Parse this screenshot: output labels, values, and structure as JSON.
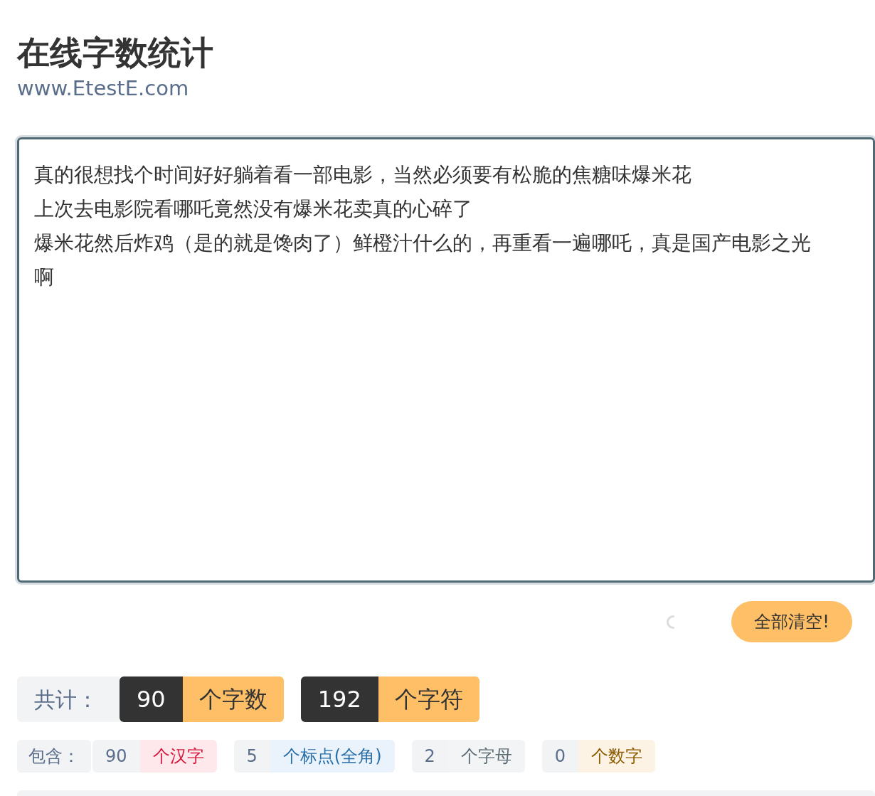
{
  "header": {
    "title": "在线字数统计",
    "subtitle": "www.EtestE.com"
  },
  "editor": {
    "lines": [
      "真的很想找个时间好好躺着看一部电影，当然必须要有松脆的焦糖味爆米花",
      "上次去电影院看哪吒竟然没有爆米花卖真的心碎了",
      "爆米花然后炸鸡（是的就是馋肉了）鲜橙汁什么的，再重看一遍哪吒，真是国产电影之光啊"
    ]
  },
  "clear_button": "全部清空!",
  "totals": {
    "label": "共计：",
    "items": [
      {
        "count": "90",
        "unit": "个字数"
      },
      {
        "count": "192",
        "unit": "个字符"
      }
    ]
  },
  "breakdown": {
    "label": "包含：",
    "items": [
      {
        "count": "90",
        "unit": "个汉字",
        "color": "#d6183c"
      },
      {
        "count": "5",
        "unit": "个标点(全角)",
        "color": "#2b6fa8"
      },
      {
        "count": "2",
        "unit": "个字母",
        "color": "#5b6b73"
      },
      {
        "count": "0",
        "unit": "个数字",
        "color": "#8a5a00"
      }
    ]
  }
}
